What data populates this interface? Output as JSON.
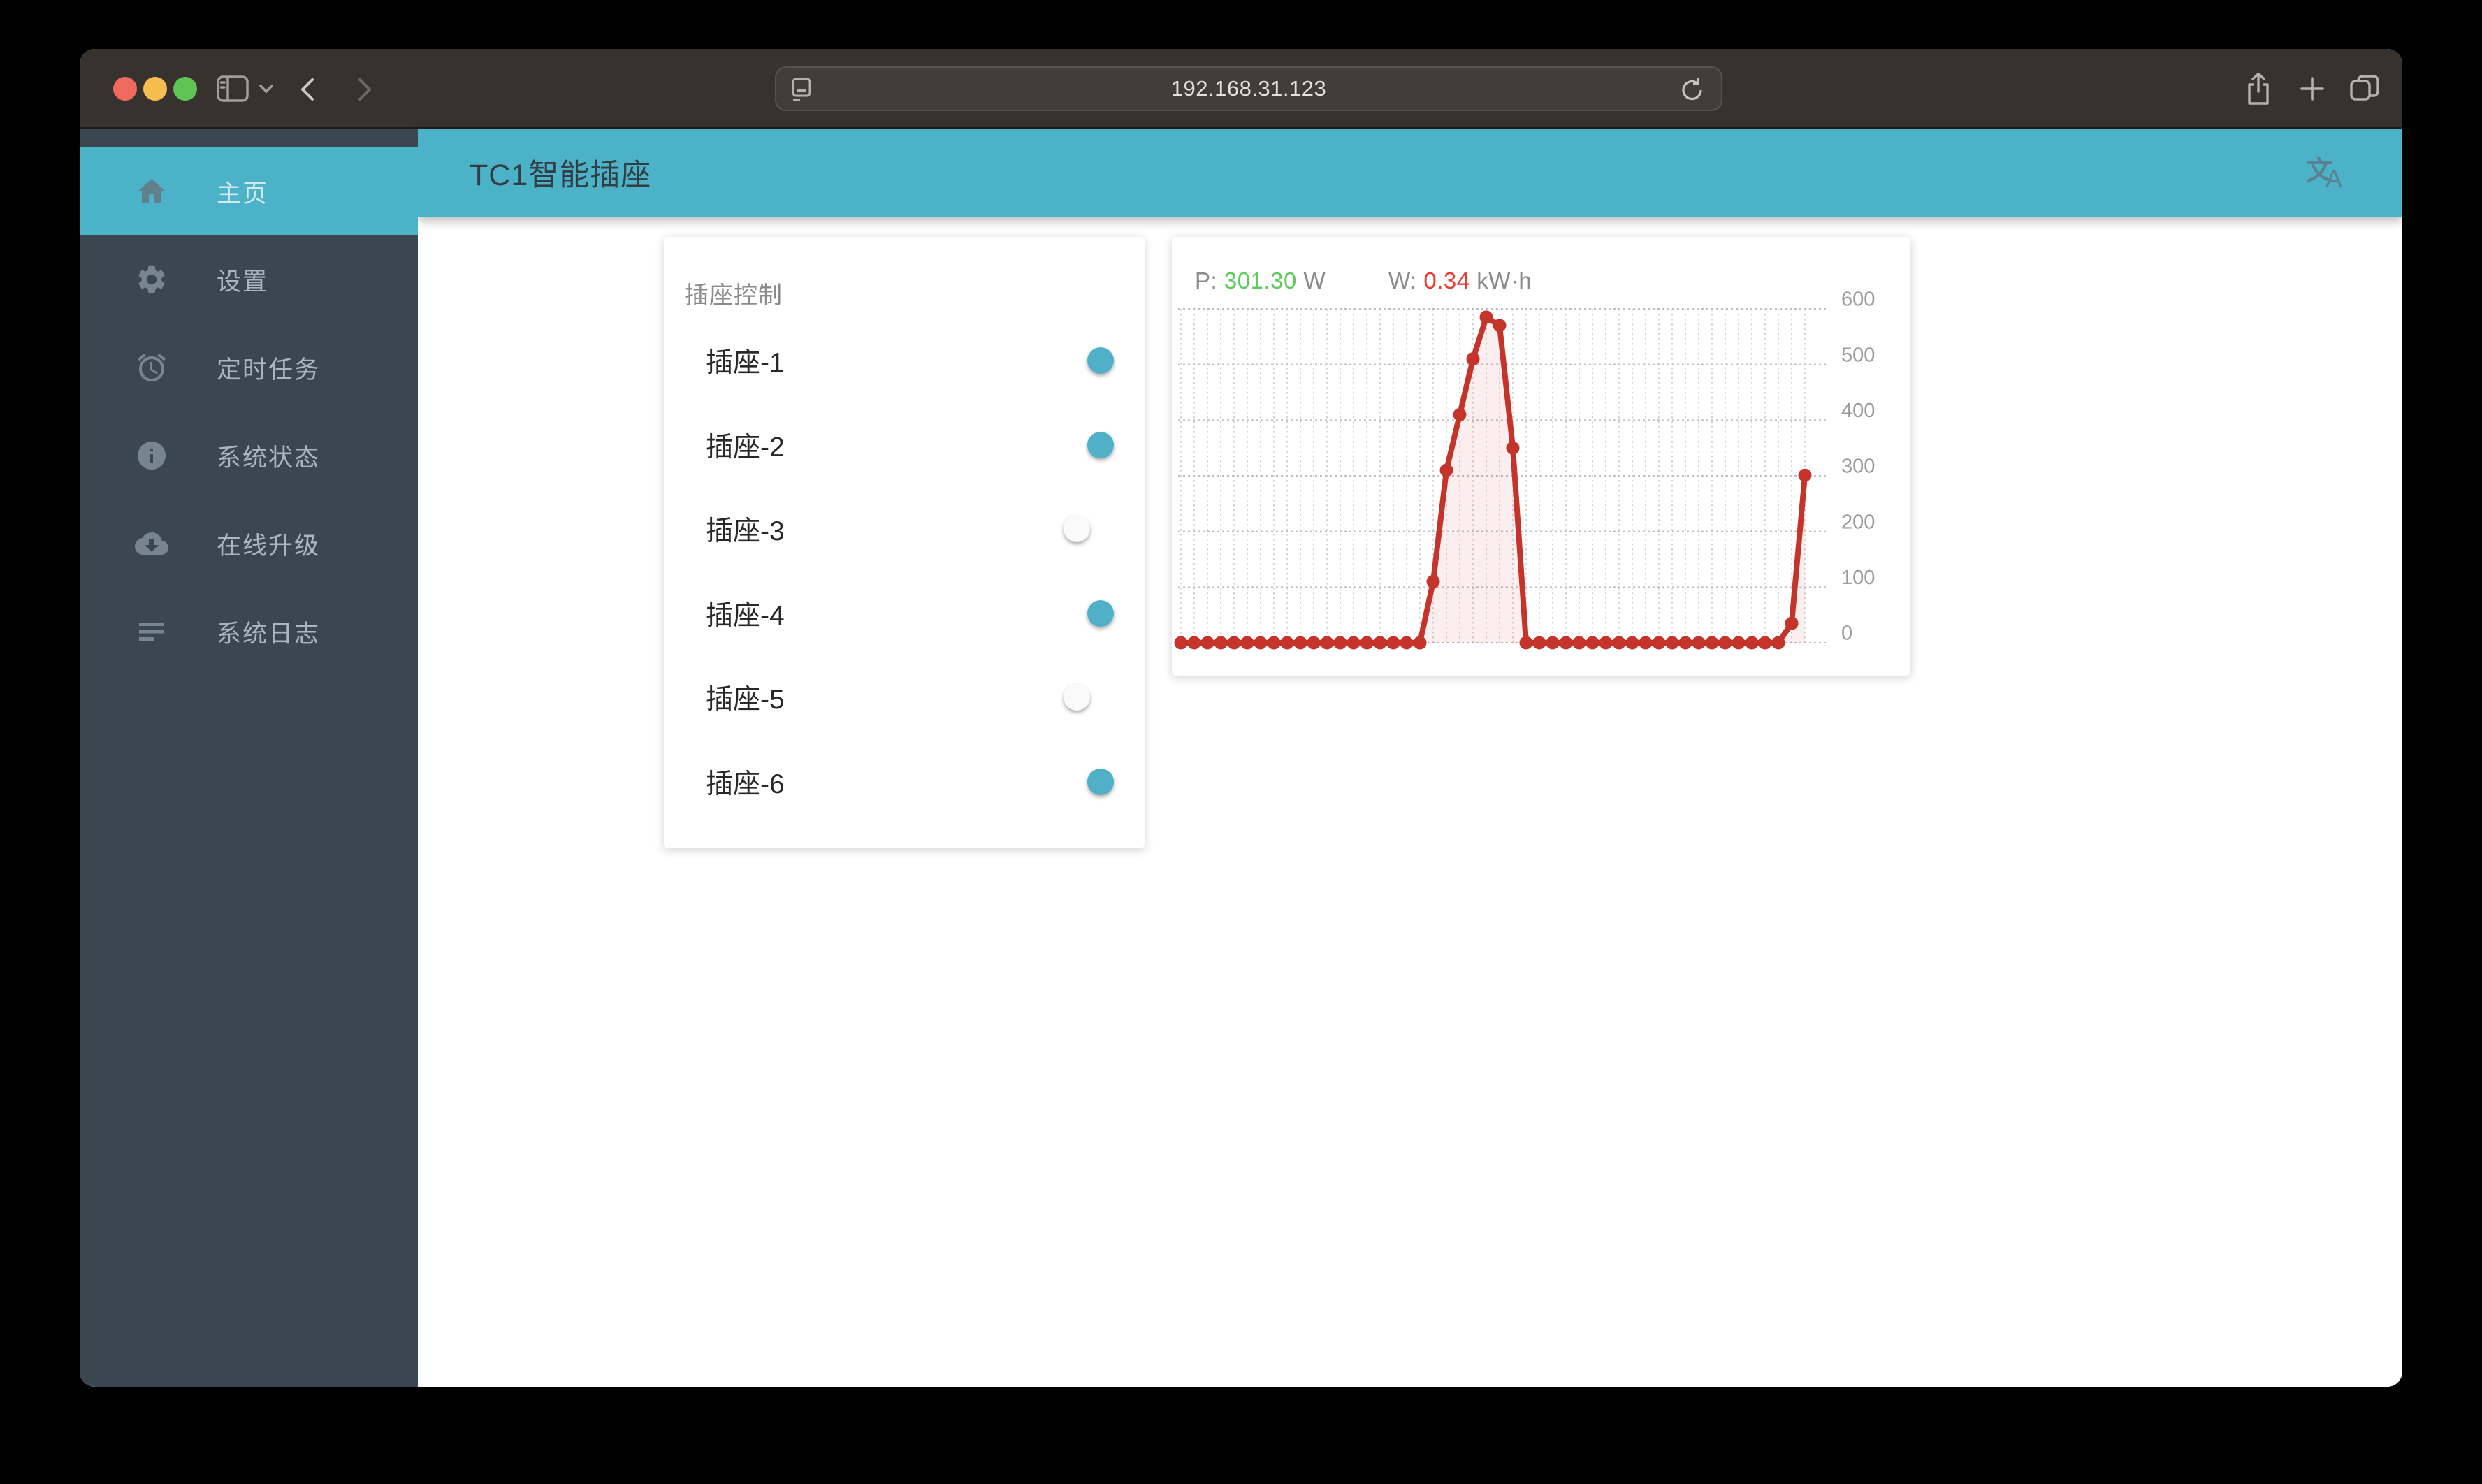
{
  "browser": {
    "url": "192.168.31.123",
    "traffic_lights": {
      "close": "#ee6a5f",
      "minimize": "#f5bd4f",
      "zoom": "#61c354"
    },
    "toolbar_icons": [
      "sidebar-toggle",
      "chevron-down",
      "back",
      "forward",
      "page-settings",
      "reload",
      "share",
      "new-tab",
      "show-tabs"
    ]
  },
  "header": {
    "title": "TC1智能插座",
    "translate_icon": {
      "char_top": "文",
      "char_bottom": "A"
    }
  },
  "sidebar": {
    "items": [
      {
        "label": "主页",
        "icon": "home-icon",
        "active": true
      },
      {
        "label": "设置",
        "icon": "gear-icon",
        "active": false
      },
      {
        "label": "定时任务",
        "icon": "alarm-clock-icon",
        "active": false
      },
      {
        "label": "系统状态",
        "icon": "info-icon",
        "active": false
      },
      {
        "label": "在线升级",
        "icon": "cloud-download-icon",
        "active": false
      },
      {
        "label": "系统日志",
        "icon": "log-lines-icon",
        "active": false
      }
    ]
  },
  "socket_card": {
    "title": "插座控制",
    "sockets": [
      {
        "label": "插座-1",
        "on": true
      },
      {
        "label": "插座-2",
        "on": true
      },
      {
        "label": "插座-3",
        "on": false
      },
      {
        "label": "插座-4",
        "on": true
      },
      {
        "label": "插座-5",
        "on": false
      },
      {
        "label": "插座-6",
        "on": true
      }
    ]
  },
  "power_card": {
    "p_label": "P: ",
    "p_value": "301.30",
    "p_unit": " W",
    "w_label": "W: ",
    "w_value": "0.34",
    "w_unit": " kW·h"
  },
  "chart_data": {
    "type": "line",
    "title": "",
    "xlabel": "",
    "ylabel": "",
    "x": "time (unlabeled ticks, one dashed gridline per sample)",
    "series": [
      {
        "name": "power_w",
        "values": [
          0,
          0,
          0,
          0,
          0,
          0,
          0,
          0,
          0,
          0,
          0,
          0,
          0,
          0,
          0,
          0,
          0,
          0,
          0,
          110,
          310,
          410,
          510,
          585,
          570,
          350,
          0,
          0,
          0,
          0,
          0,
          0,
          0,
          0,
          0,
          0,
          0,
          0,
          0,
          0,
          0,
          0,
          0,
          0,
          0,
          0,
          35,
          301
        ]
      }
    ],
    "ylim": [
      0,
      600
    ],
    "y_ticks": [
      0,
      100,
      200,
      300,
      400,
      500,
      600
    ],
    "grid": "dashed",
    "legend_position": "none",
    "line_color": "#c5342b",
    "fill_color": "rgba(197,52,43,0.08)",
    "tick_label_color": "#9a9a9a"
  },
  "colors": {
    "accent_teal": "#4bb2c7",
    "sidebar_bg": "#3b4750",
    "chrome_bg": "#38322e",
    "value_green": "#5ecb5e",
    "value_red": "#e63b30",
    "toggle_on_thumb": "#4fb0c8",
    "toggle_on_track": "#a8d5e2",
    "toggle_off_thumb": "#fafafa",
    "toggle_off_track": "#b9b9b9"
  }
}
